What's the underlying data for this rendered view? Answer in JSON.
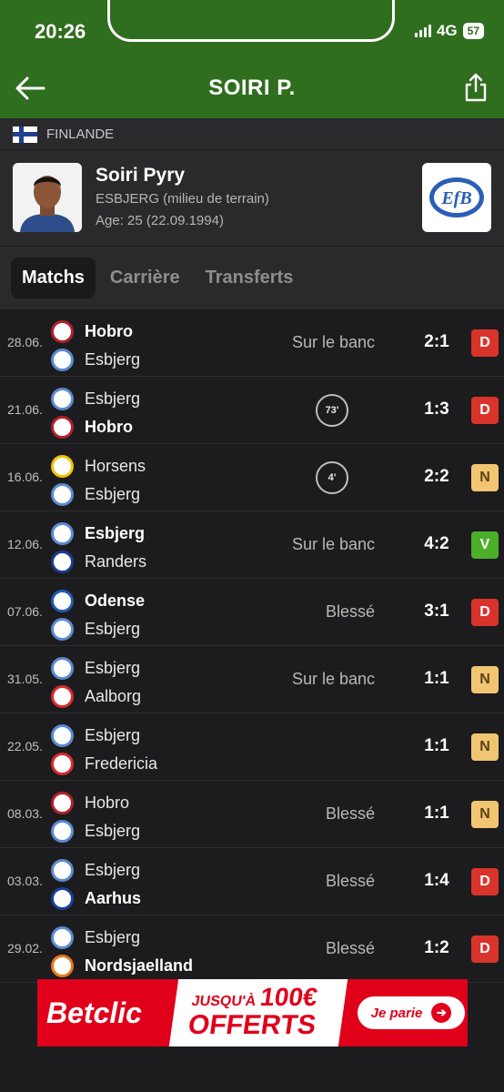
{
  "status_bar": {
    "time": "20:26",
    "network": "4G",
    "battery": "57"
  },
  "header": {
    "title": "SOIRI P."
  },
  "country": {
    "name": "FINLANDE"
  },
  "player": {
    "name": "Soiri Pyry",
    "club_position": "ESBJERG (milieu de terrain)",
    "age": "Age: 25 (22.09.1994)"
  },
  "tabs": [
    {
      "label": "Matchs",
      "active": true
    },
    {
      "label": "Carrière",
      "active": false
    },
    {
      "label": "Transferts",
      "active": false
    }
  ],
  "matches": [
    {
      "date": "28.06.",
      "team1": "Hobro",
      "team1_bold": true,
      "team2": "Esbjerg",
      "team2_bold": false,
      "status": "Sur le banc",
      "minute": "",
      "score": "2:1",
      "result": "D"
    },
    {
      "date": "21.06.",
      "team1": "Esbjerg",
      "team1_bold": false,
      "team2": "Hobro",
      "team2_bold": true,
      "status": "",
      "minute": "73'",
      "score": "1:3",
      "result": "D"
    },
    {
      "date": "16.06.",
      "team1": "Horsens",
      "team1_bold": false,
      "team2": "Esbjerg",
      "team2_bold": false,
      "status": "",
      "minute": "4'",
      "score": "2:2",
      "result": "N"
    },
    {
      "date": "12.06.",
      "team1": "Esbjerg",
      "team1_bold": true,
      "team2": "Randers",
      "team2_bold": false,
      "status": "Sur le banc",
      "minute": "",
      "score": "4:2",
      "result": "V"
    },
    {
      "date": "07.06.",
      "team1": "Odense",
      "team1_bold": true,
      "team2": "Esbjerg",
      "team2_bold": false,
      "status": "Blessé",
      "minute": "",
      "score": "3:1",
      "result": "D"
    },
    {
      "date": "31.05.",
      "team1": "Esbjerg",
      "team1_bold": false,
      "team2": "Aalborg",
      "team2_bold": false,
      "status": "Sur le banc",
      "minute": "",
      "score": "1:1",
      "result": "N"
    },
    {
      "date": "22.05.",
      "team1": "Esbjerg",
      "team1_bold": false,
      "team2": "Fredericia",
      "team2_bold": false,
      "status": "",
      "minute": "",
      "score": "1:1",
      "result": "N"
    },
    {
      "date": "08.03.",
      "team1": "Hobro",
      "team1_bold": false,
      "team2": "Esbjerg",
      "team2_bold": false,
      "status": "Blessé",
      "minute": "",
      "score": "1:1",
      "result": "N"
    },
    {
      "date": "03.03.",
      "team1": "Esbjerg",
      "team1_bold": false,
      "team2": "Aarhus",
      "team2_bold": true,
      "status": "Blessé",
      "minute": "",
      "score": "1:4",
      "result": "D"
    },
    {
      "date": "29.02.",
      "team1": "Esbjerg",
      "team1_bold": false,
      "team2": "Nordsjaelland",
      "team2_bold": true,
      "status": "Blessé",
      "minute": "",
      "score": "1:2",
      "result": "D"
    }
  ],
  "team_colors": {
    "Hobro": "#b3202a",
    "Esbjerg": "#5b8bd0",
    "Horsens": "#f2c300",
    "Randers": "#1d3c8f",
    "Odense": "#1f5cb8",
    "Aalborg": "#d92b2b",
    "Fredericia": "#d92b2b",
    "Aarhus": "#1a3f9c",
    "Nordsjaelland": "#e8791a"
  },
  "ad": {
    "brand": "Betclic",
    "line1_prefix": "JUSQU'À",
    "line1_amount": "100€",
    "line2": "OFFERTS",
    "cta": "Je parie"
  }
}
